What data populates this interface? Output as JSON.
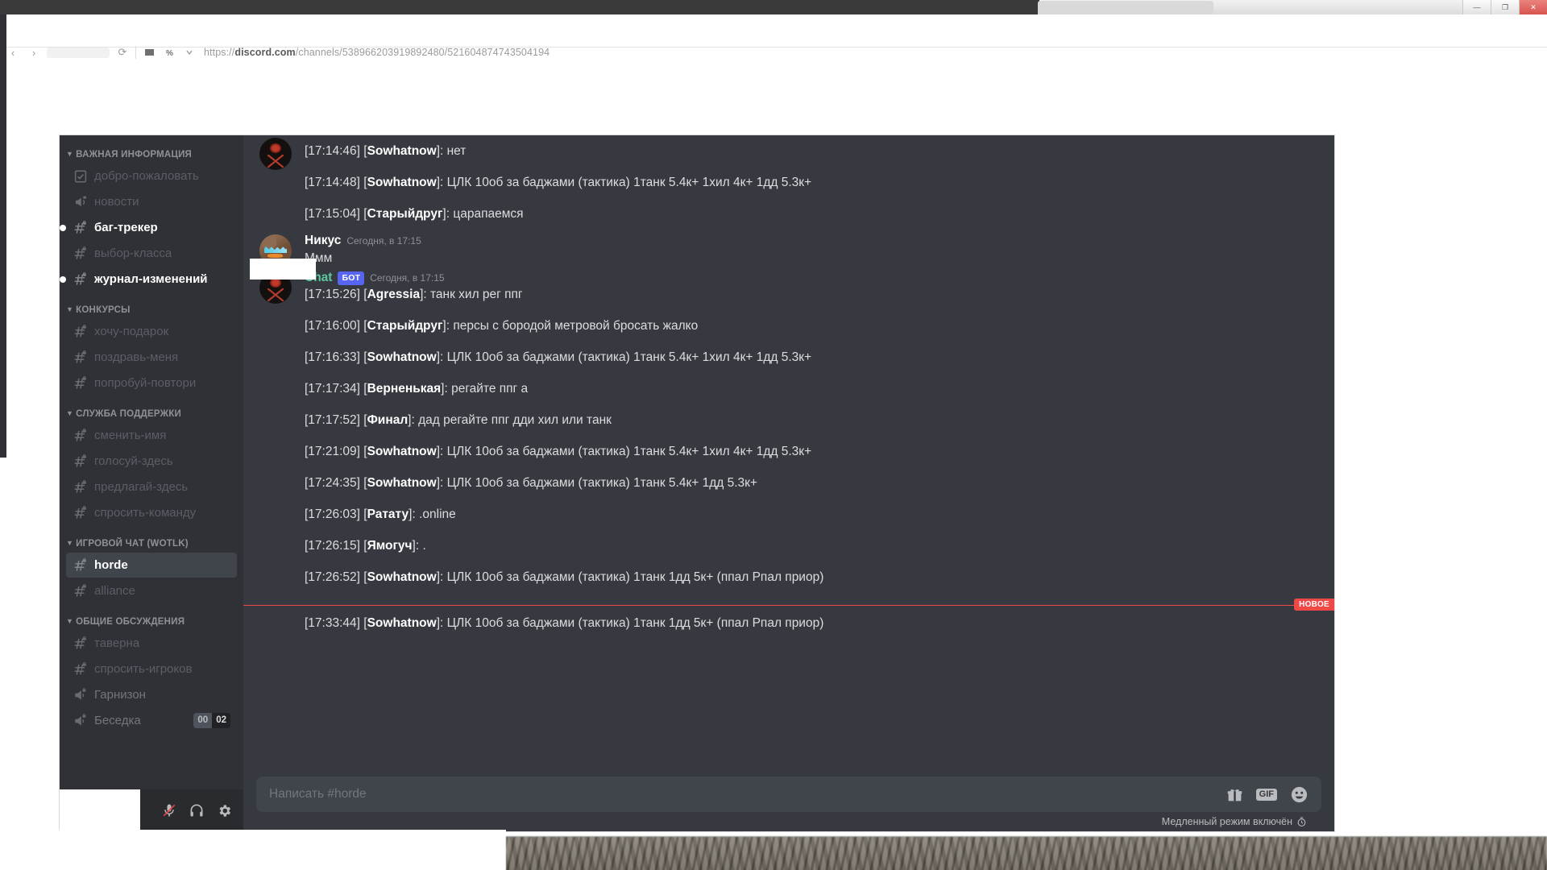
{
  "browser": {
    "url_prefix": "https://",
    "url_domain": "discord.com",
    "url_path": "/channels/538966203919892480/521604874743504194",
    "window_minimize": "—",
    "window_maximize": "❐",
    "window_close": "✕",
    "back_icon": "‹",
    "forward_icon": "›",
    "reload_icon": "⟳"
  },
  "sidebar": {
    "groups": [
      {
        "name": "ВАЖНАЯ ИНФОРМАЦИЯ",
        "channels": [
          {
            "label": "добро-пожаловать",
            "icon": "rules-channel-icon",
            "state": "dim"
          },
          {
            "label": "новости",
            "icon": "announcement-channel-icon",
            "state": "dim"
          },
          {
            "label": "баг-трекер",
            "icon": "hash-lock-icon",
            "state": "unread"
          },
          {
            "label": "выбор-класса",
            "icon": "hash-lock-icon",
            "state": "dim"
          },
          {
            "label": "журнал-изменений",
            "icon": "hash-lock-icon",
            "state": "unread"
          }
        ]
      },
      {
        "name": "КОНКУРСЫ",
        "channels": [
          {
            "label": "хочу-подарок",
            "icon": "hash-lock-icon",
            "state": "dim"
          },
          {
            "label": "поздравь-меня",
            "icon": "hash-lock-icon",
            "state": "dim"
          },
          {
            "label": "попробуй-повтори",
            "icon": "hash-lock-icon",
            "state": "dim"
          }
        ]
      },
      {
        "name": "СЛУЖБА ПОДДЕРЖКИ",
        "channels": [
          {
            "label": "сменить-имя",
            "icon": "hash-lock-icon",
            "state": "muted"
          },
          {
            "label": "голосуй-здесь",
            "icon": "hash-lock-icon",
            "state": "muted"
          },
          {
            "label": "предлагай-здесь",
            "icon": "hash-lock-icon",
            "state": "muted"
          },
          {
            "label": "спросить-команду",
            "icon": "hash-lock-icon",
            "state": "muted"
          }
        ]
      },
      {
        "name": "ИГРОВОЙ ЧАТ (WOTLK)",
        "channels": [
          {
            "label": "horde",
            "icon": "hash-lock-icon",
            "state": "selected"
          },
          {
            "label": "alliance",
            "icon": "hash-lock-icon",
            "state": "muted"
          }
        ]
      },
      {
        "name": "ОБЩИЕ ОБСУЖДЕНИЯ",
        "channels": [
          {
            "label": "таверна",
            "icon": "hash-lock-icon",
            "state": "muted"
          },
          {
            "label": "спросить-игроков",
            "icon": "hash-lock-icon",
            "state": "muted"
          },
          {
            "label": "Гарнизон",
            "icon": "voice-channel-lock-icon",
            "state": "voice"
          },
          {
            "label": "Беседка",
            "icon": "voice-channel-lock-icon",
            "state": "voice",
            "count_current": "00",
            "count_limit": "02"
          }
        ]
      }
    ],
    "user_panel": {
      "mute_icon": "microphone-muted-icon",
      "deafen_icon": "headphones-icon",
      "settings_icon": "gear-icon"
    }
  },
  "chat": {
    "messages": [
      {
        "type": "grouped-lines",
        "lines": [
          {
            "time": "[17:14:46]",
            "nick": "Sowhatnow",
            "text": "нет"
          },
          {
            "time": "[17:14:48]",
            "nick": "Sowhatnow",
            "text": "ЦЛК 10об за баджами (тактика) 1танк 5.4к+ 1хил 4к+ 1дд 5.3к+"
          },
          {
            "time": "[17:15:04]",
            "nick": "Старыйдруг",
            "text": "царапаемся"
          }
        ]
      },
      {
        "type": "user",
        "author": "Никус",
        "avatar": "nikus-avatar",
        "timestamp": "Сегодня, в 17:15",
        "text": "Ммм"
      },
      {
        "type": "bot",
        "author": "Chat",
        "avatar": "bot-avatar",
        "bot_tag": "БОТ",
        "timestamp": "Сегодня, в 17:15",
        "lines": [
          {
            "time": "[17:15:26]",
            "nick": "Agressia",
            "text": "танк хил рег ппг"
          },
          {
            "time": "[17:16:00]",
            "nick": "Старыйдруг",
            "text": "персы с бородой метровой бросать жалко"
          },
          {
            "time": "[17:16:33]",
            "nick": "Sowhatnow",
            "text": "ЦЛК 10об за баджами (тактика) 1танк 5.4к+ 1хил 4к+ 1дд 5.3к+"
          },
          {
            "time": "[17:17:34]",
            "nick": "Верненькая",
            "text": "регайте ппг а"
          },
          {
            "time": "[17:17:52]",
            "nick": "Финал",
            "text": "дад регайте ппг дди хил или танк"
          },
          {
            "time": "[17:21:09]",
            "nick": "Sowhatnow",
            "text": "ЦЛК 10об за баджами (тактика) 1танк 5.4к+ 1хил 4к+ 1дд 5.3к+"
          },
          {
            "time": "[17:24:35]",
            "nick": "Sowhatnow",
            "text": "ЦЛК 10об за баджами (тактика) 1танк 5.4к+ 1дд 5.3к+"
          },
          {
            "time": "[17:26:03]",
            "nick": "Ратату",
            "text": ".online"
          },
          {
            "time": "[17:26:15]",
            "nick": "Ямогуч",
            "text": "."
          },
          {
            "time": "[17:26:52]",
            "nick": "Sowhatnow",
            "text": "ЦЛК 10об за баджами (тактика) 1танк 1дд 5к+ (ппал Рпал приор)"
          }
        ]
      }
    ],
    "new_divider_label": "НОВОЕ",
    "after_divider": {
      "time": "[17:33:44]",
      "nick": "Sowhatnow",
      "text": "ЦЛК 10об за баджами (тактика) 1танк 1дд 5к+ (ппал Рпал приор)"
    },
    "composer": {
      "placeholder": "Написать #horde",
      "gift_icon": "gift-icon",
      "gif_label": "GIF",
      "emoji_icon": "emoji-icon"
    },
    "slowmode": {
      "text": "Медленный режим включён",
      "icon": "clock-icon"
    }
  }
}
